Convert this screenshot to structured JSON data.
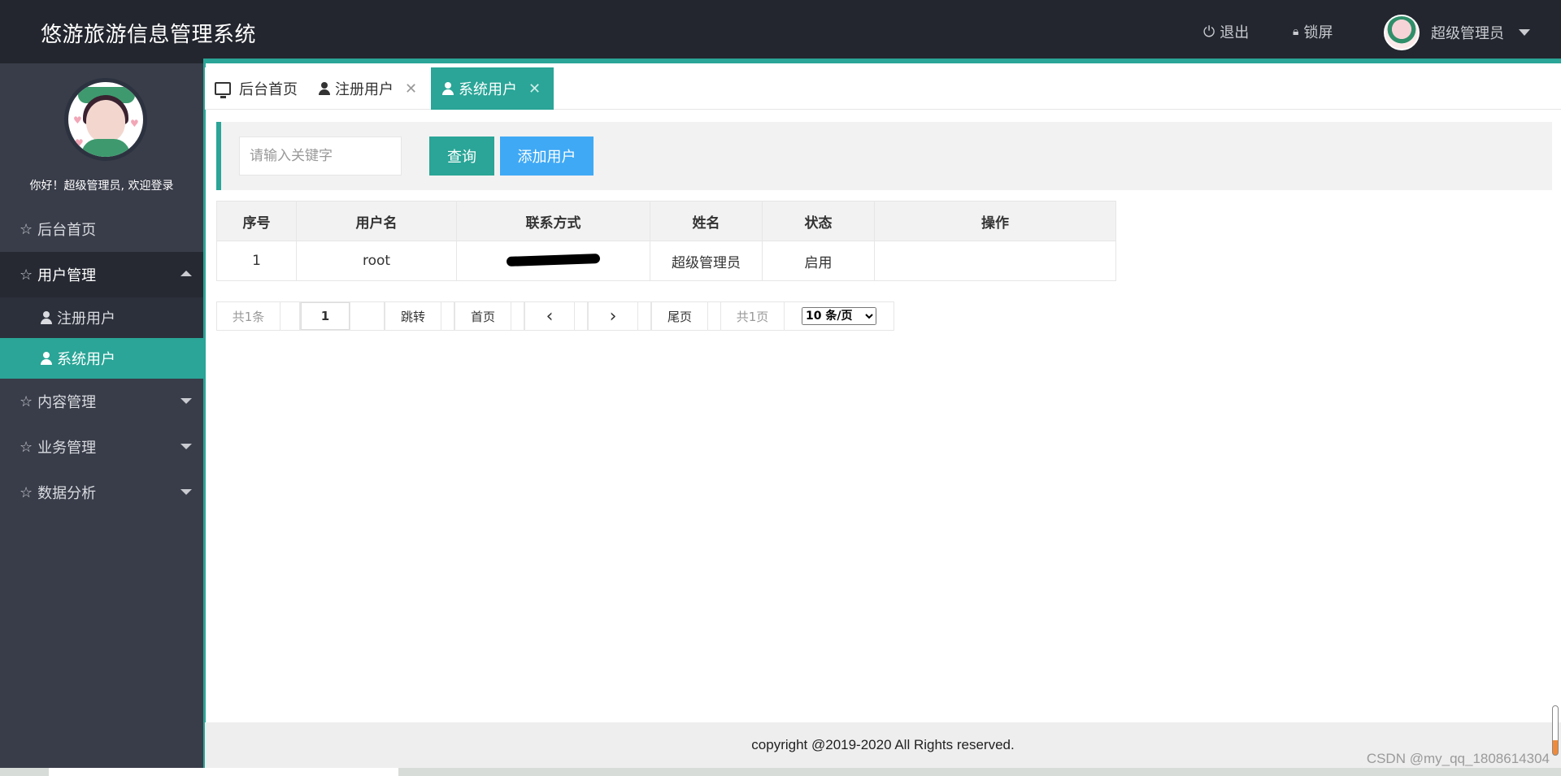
{
  "app": {
    "title": "悠游旅游信息管理系统"
  },
  "header": {
    "logout_label": "退出",
    "lock_label": "锁屏",
    "user_name": "超级管理员"
  },
  "sidebar": {
    "welcome": "你好！超级管理员, 欢迎登录",
    "items": [
      {
        "label": "后台首页"
      },
      {
        "label": "用户管理",
        "expanded": true
      },
      {
        "label": "内容管理"
      },
      {
        "label": "业务管理"
      },
      {
        "label": "数据分析"
      }
    ],
    "sub_items": [
      {
        "label": "注册用户"
      },
      {
        "label": "系统用户",
        "active": true
      }
    ]
  },
  "tabs": [
    {
      "label": "后台首页",
      "icon": "monitor-icon"
    },
    {
      "label": "注册用户",
      "icon": "user-icon"
    },
    {
      "label": "系统用户",
      "icon": "user-icon",
      "active": true
    }
  ],
  "search": {
    "placeholder": "请输入关键字",
    "query_label": "查询",
    "add_label": "添加用户"
  },
  "table": {
    "headers": [
      "序号",
      "用户名",
      "联系方式",
      "姓名",
      "状态",
      "操作"
    ],
    "rows": [
      {
        "index": "1",
        "username": "root",
        "contact": "",
        "name": "超级管理员",
        "status": "启用",
        "actions": ""
      }
    ]
  },
  "pager": {
    "total": "共1条",
    "current_page": "1",
    "jump_label": "跳转",
    "first_label": "首页",
    "prev_icon": "‹",
    "next_icon": "›",
    "last_label": "尾页",
    "pages": "共1页",
    "page_size": "10 条/页"
  },
  "footer": {
    "copyright": "copyright @2019-2020 All Rights reserved."
  },
  "watermark": "CSDN @my_qq_1808614304",
  "colors": {
    "accent": "#2aa597",
    "header_bg": "#23262e",
    "sidebar_bg": "#393d49",
    "add_button": "#3fa9f5"
  }
}
